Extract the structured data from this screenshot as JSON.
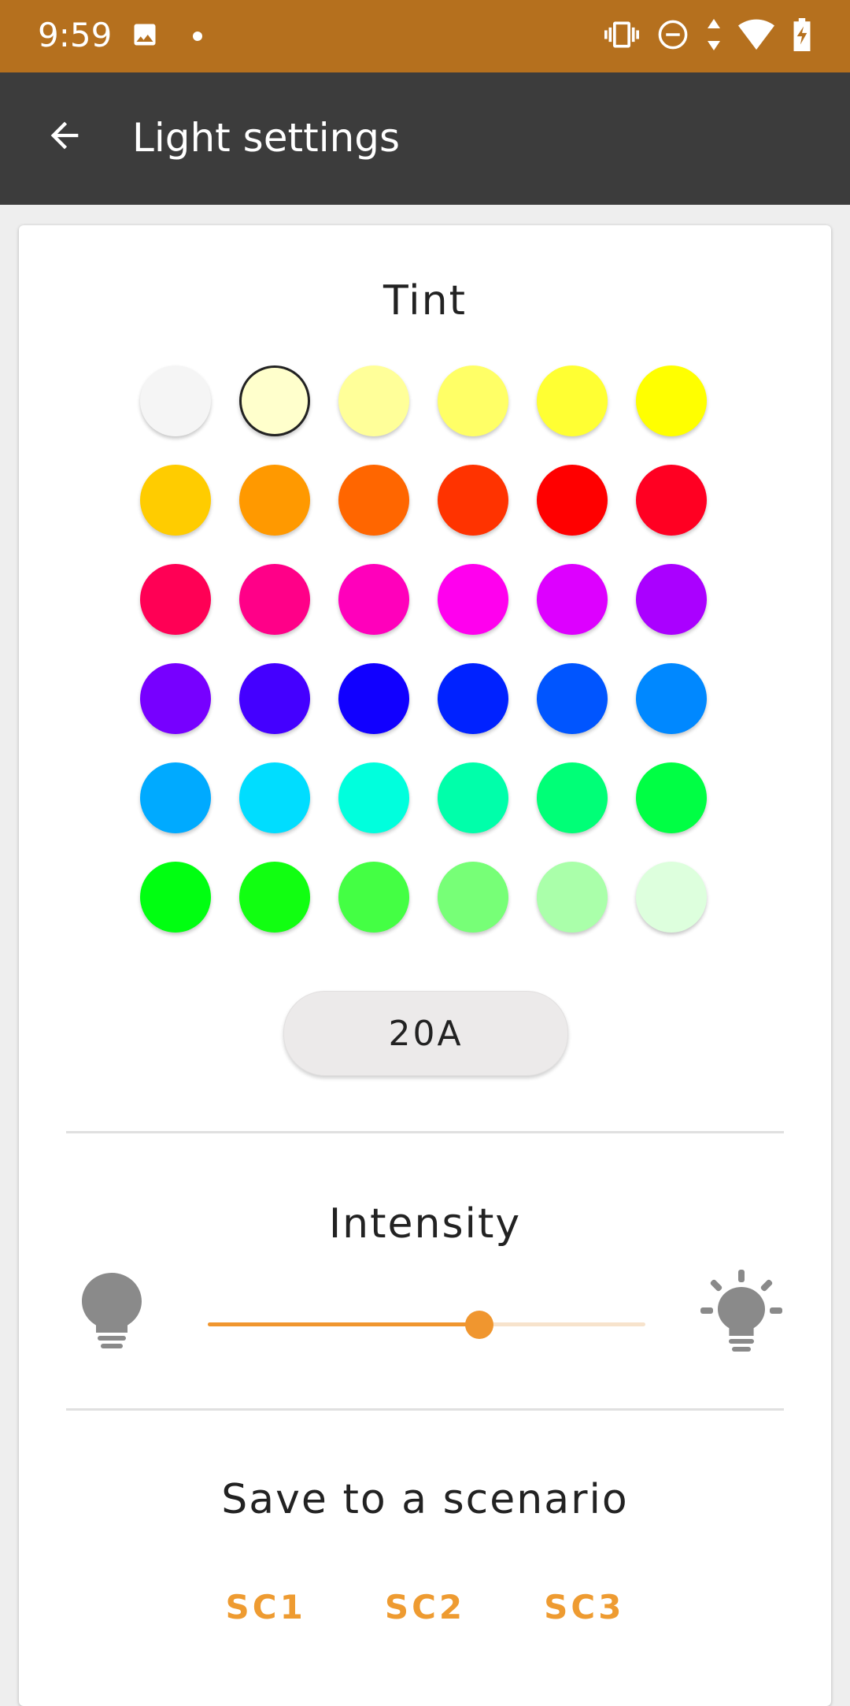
{
  "status_bar": {
    "time": "9:59",
    "icons": [
      "image-icon",
      "dot-icon",
      "vibrate-icon",
      "do-not-disturb-icon",
      "data-arrows-icon",
      "wifi-icon",
      "battery-charging-icon"
    ]
  },
  "app_bar": {
    "title": "Light settings",
    "back_icon": "arrow-back-icon"
  },
  "tint": {
    "title": "Tint",
    "selected_index": 1,
    "swatches": [
      "#f5f5f5",
      "#ffffcc",
      "#ffff99",
      "#ffff66",
      "#ffff33",
      "#ffff00",
      "#ffcc00",
      "#ff9900",
      "#ff6600",
      "#ff3300",
      "#ff0000",
      "#ff0022",
      "#ff0055",
      "#ff0088",
      "#ff00bb",
      "#ff00ee",
      "#dd00ff",
      "#aa00ff",
      "#7700ff",
      "#4400ff",
      "#1100ff",
      "#0022ff",
      "#0055ff",
      "#0088ff",
      "#00aaff",
      "#00ddff",
      "#00ffdd",
      "#00ffaa",
      "#00ff77",
      "#00ff44",
      "#00ff11",
      "#11ff11",
      "#44ff44",
      "#77ff77",
      "#aaffaa",
      "#ddffdd"
    ],
    "code_button_label": "20A"
  },
  "intensity": {
    "title": "Intensity",
    "value_fraction": 0.62,
    "low_icon": "lightbulb-off-icon",
    "high_icon": "lightbulb-on-icon",
    "accent_color": "#f0962f"
  },
  "scenario": {
    "title": "Save to a scenario",
    "buttons": [
      "SC1",
      "SC2",
      "SC3"
    ]
  },
  "colors": {
    "status_bar": "#b5701e",
    "app_bar": "#3c3c3c",
    "accent": "#ee9b31"
  }
}
